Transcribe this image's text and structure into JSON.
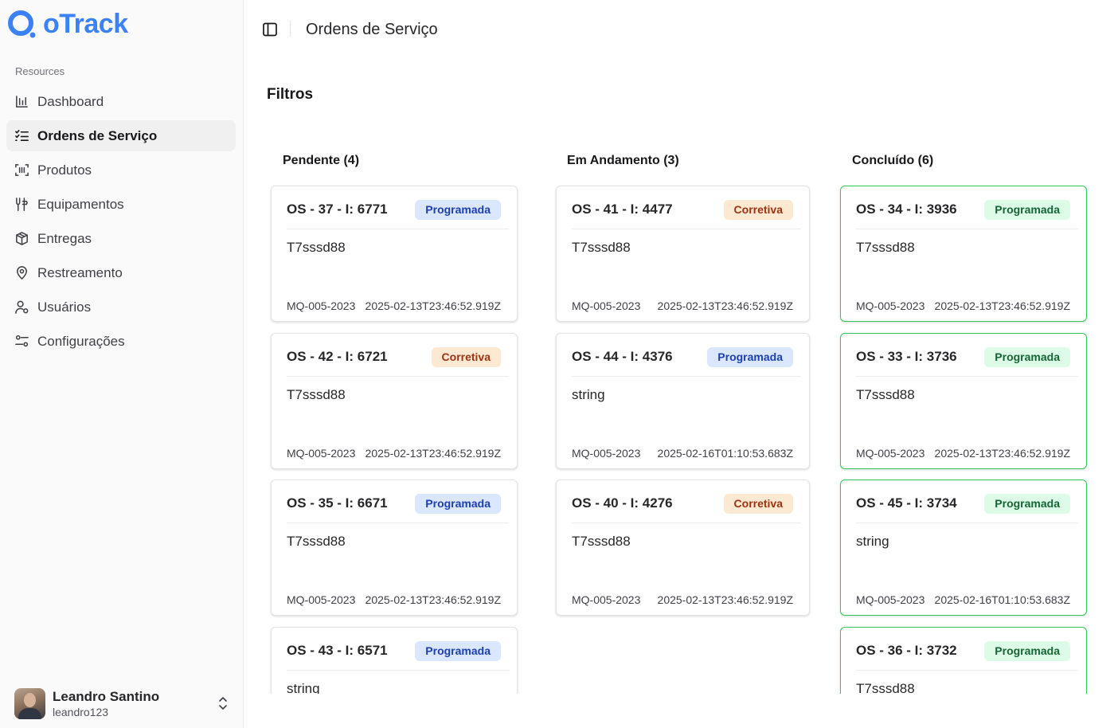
{
  "app": {
    "name": "oTrack"
  },
  "sidebar": {
    "section": "Resources",
    "items": [
      {
        "label": "Dashboard",
        "icon": "bar-chart-icon"
      },
      {
        "label": "Ordens de Serviço",
        "icon": "list-checks-icon"
      },
      {
        "label": "Produtos",
        "icon": "scan-barcode-icon"
      },
      {
        "label": "Equipamentos",
        "icon": "wrench-icon"
      },
      {
        "label": "Entregas",
        "icon": "package-icon"
      },
      {
        "label": "Restreamento",
        "icon": "map-pin-icon"
      },
      {
        "label": "Usuários",
        "icon": "user-icon"
      },
      {
        "label": "Configurações",
        "icon": "settings-sliders-icon"
      }
    ],
    "active_item": "Ordens de Serviço",
    "user": {
      "name": "Leandro Santino",
      "login": "leandro123"
    }
  },
  "header": {
    "title": "Ordens de Serviço"
  },
  "filters": {
    "title": "Filtros"
  },
  "colors": {
    "brand": "#3b82f6",
    "programada_bg": "#dbe7fe",
    "corretiva_bg": "#fde8d2",
    "concluido_border": "#34c759"
  },
  "board": {
    "columns": [
      {
        "title": "Pendente (4)",
        "cards": [
          {
            "title": "OS - 37 - I: 6771",
            "badge": "Programada",
            "description": "T7sssd88",
            "code": "MQ-005-2023",
            "date": "2025-02-13T23:46:52.919Z"
          },
          {
            "title": "OS - 42 - I: 6721",
            "badge": "Corretiva",
            "description": "T7sssd88",
            "code": "MQ-005-2023",
            "date": "2025-02-13T23:46:52.919Z"
          },
          {
            "title": "OS - 35 - I: 6671",
            "badge": "Programada",
            "description": "T7sssd88",
            "code": "MQ-005-2023",
            "date": "2025-02-13T23:46:52.919Z"
          },
          {
            "title": "OS - 43 - I: 6571",
            "badge": "Programada",
            "description": "string",
            "code": "",
            "date": ""
          }
        ]
      },
      {
        "title": "Em Andamento (3)",
        "cards": [
          {
            "title": "OS - 41 - I: 4477",
            "badge": "Corretiva",
            "description": "T7sssd88",
            "code": "MQ-005-2023",
            "date": "2025-02-13T23:46:52.919Z"
          },
          {
            "title": "OS - 44 - I: 4376",
            "badge": "Programada",
            "description": "string",
            "code": "MQ-005-2023",
            "date": "2025-02-16T01:10:53.683Z"
          },
          {
            "title": "OS - 40 - I: 4276",
            "badge": "Corretiva",
            "description": "T7sssd88",
            "code": "MQ-005-2023",
            "date": "2025-02-13T23:46:52.919Z"
          }
        ]
      },
      {
        "title": "Concluído (6)",
        "cards": [
          {
            "title": "OS - 34 - I: 3936",
            "badge": "Programada",
            "description": "T7sssd88",
            "code": "MQ-005-2023",
            "date": "2025-02-13T23:46:52.919Z"
          },
          {
            "title": "OS - 33 - I: 3736",
            "badge": "Programada",
            "description": "T7sssd88",
            "code": "MQ-005-2023",
            "date": "2025-02-13T23:46:52.919Z"
          },
          {
            "title": "OS - 45 - I: 3734",
            "badge": "Programada",
            "description": "string",
            "code": "MQ-005-2023",
            "date": "2025-02-16T01:10:53.683Z"
          },
          {
            "title": "OS - 36 - I: 3732",
            "badge": "Programada",
            "description": "T7sssd88",
            "code": "",
            "date": ""
          }
        ]
      }
    ]
  }
}
